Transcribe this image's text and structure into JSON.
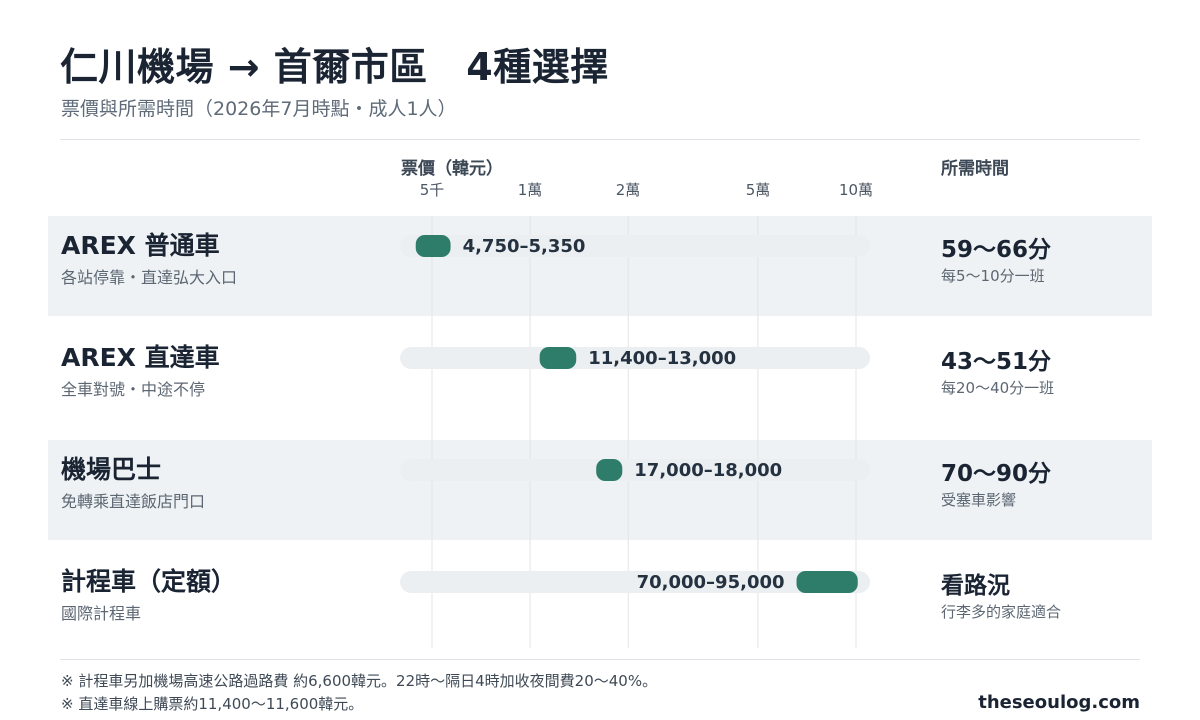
{
  "title": "仁川機場 → 首爾市區　4種選擇",
  "subtitle": "票價與所需時間（2026年7月時點・成人1人）",
  "columns": {
    "price": "票價（韓元）",
    "time": "所需時間"
  },
  "footnotes": [
    "※ 計程車另加機場高速公路過路費 約6,600韓元。22時〜隔日4時加收夜間費20〜40%。",
    "※ 直達車線上購票約11,400〜11,600韓元。"
  ],
  "brand": "theseoulog.com",
  "colors": {
    "accent": "#2e7d6b",
    "track": "#eceff1",
    "shade": "#eff2f4",
    "gridline": "#e1e4e7"
  },
  "chart_data": {
    "type": "range",
    "scale": "log",
    "xlabel": "票價（韓元）",
    "xlim": [
      5000,
      100000
    ],
    "ticks": [
      {
        "value": 5000,
        "label": "5千"
      },
      {
        "value": 10000,
        "label": "1萬"
      },
      {
        "value": 20000,
        "label": "2萬"
      },
      {
        "value": 50000,
        "label": "5萬"
      },
      {
        "value": 100000,
        "label": "10萬"
      }
    ],
    "rows": [
      {
        "name": "AREX 普通車",
        "desc": "各站停靠・直達弘大入口",
        "min": 4750,
        "max": 5350,
        "label": "4,750–5,350",
        "label_side": "right",
        "time": "59〜66分",
        "note": "每5〜10分一班"
      },
      {
        "name": "AREX 直達車",
        "desc": "全車對號・中途不停",
        "min": 11400,
        "max": 13000,
        "label": "11,400–13,000",
        "label_side": "right",
        "time": "43〜51分",
        "note": "每20〜40分一班"
      },
      {
        "name": "機場巴士",
        "desc": "免轉乘直達飯店門口",
        "min": 17000,
        "max": 18000,
        "label": "17,000–18,000",
        "label_side": "right",
        "time": "70〜90分",
        "note": "受塞車影響"
      },
      {
        "name": "計程車（定額）",
        "desc": "國際計程車",
        "min": 70000,
        "max": 95000,
        "label": "70,000–95,000",
        "label_side": "left",
        "time": "看路況",
        "note": "行李多的家庭適合"
      }
    ]
  }
}
